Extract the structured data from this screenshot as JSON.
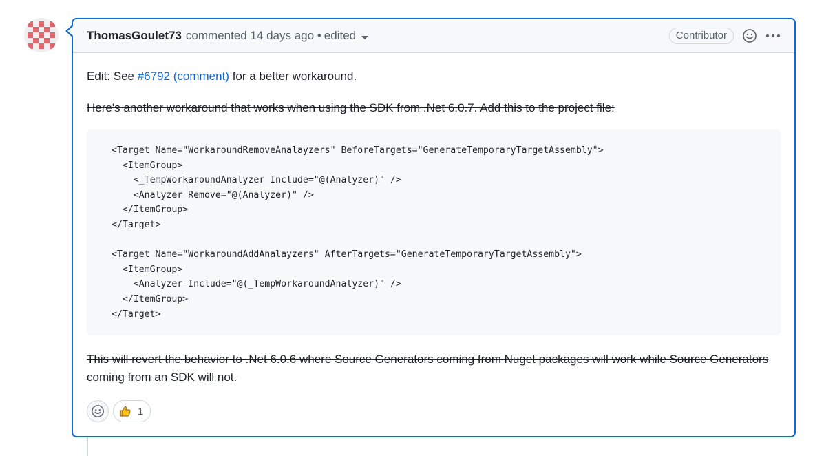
{
  "comment": {
    "author": "ThomasGoulet73",
    "meta": "commented 14 days ago •",
    "edited": "edited",
    "badge": "Contributor",
    "edit_prefix": "Edit: See ",
    "issue_link": "#6792",
    "comment_link": "(comment)",
    "edit_suffix": " for a better workaround.",
    "para2": "Here's another workaround that works when using the SDK from .Net 6.0.7. Add this to the project file:",
    "code": "<Target Name=\"WorkaroundRemoveAnalayzers\" BeforeTargets=\"GenerateTemporaryTargetAssembly\">\n  <ItemGroup>\n    <_TempWorkaroundAnalyzer Include=\"@(Analyzer)\" />\n    <Analyzer Remove=\"@(Analyzer)\" />\n  </ItemGroup>\n</Target>\n\n<Target Name=\"WorkaroundAddAnalayzers\" AfterTargets=\"GenerateTemporaryTargetAssembly\">\n  <ItemGroup>\n    <Analyzer Include=\"@(_TempWorkaroundAnalyzer)\" />\n  </ItemGroup>\n</Target>",
    "para3": "This will revert the behavior to .Net 6.0.6 where Source Generators coming from Nuget packages will work while Source Generators coming from an SDK will not."
  },
  "reactions": {
    "thumbs_up_count": "1"
  },
  "icons": {
    "avatar": "avatar-identicon",
    "emoji": "smiley-icon",
    "more": "kebab-horizontal-icon",
    "thumbs_up": "thumbs-up-icon"
  },
  "colors": {
    "accent": "#0969da",
    "avatar_red": "#e06670"
  }
}
